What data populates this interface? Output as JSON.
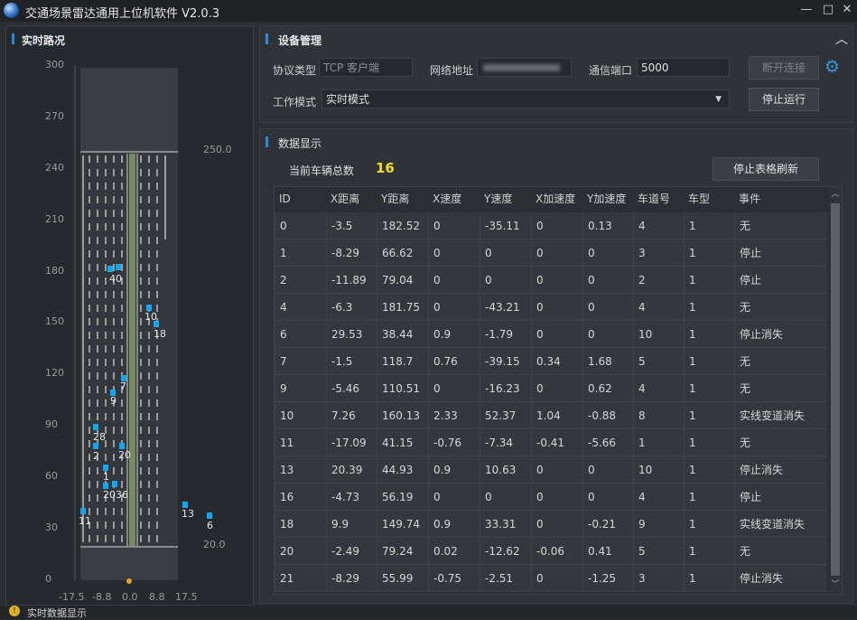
{
  "window": {
    "title": "交通场景雷达通用上位机软件 V2.0.3",
    "controls": {
      "minimize": "—",
      "maximize": "□",
      "close": "✕"
    }
  },
  "road": {
    "title": "实时路况",
    "y_ticks": [
      "300",
      "270",
      "240",
      "210",
      "180",
      "150",
      "120",
      "90",
      "60",
      "30",
      "0"
    ],
    "x_ticks": [
      "-17.5",
      "-8.8",
      "0.0",
      "8.8",
      "17.5"
    ],
    "dist_top": "250.0",
    "dist_bottom": "20.0",
    "vehicles": [
      {
        "label": "40",
        "y": 182,
        "lane": 0
      },
      {
        "label": "10",
        "y": 160,
        "lane": 0
      },
      {
        "label": "18",
        "y": 150,
        "lane": 0
      },
      {
        "label": "7",
        "y": 118,
        "lane": 0
      },
      {
        "label": "9",
        "y": 110,
        "lane": 0
      },
      {
        "label": "28",
        "y": 90,
        "lane": 0
      },
      {
        "label": "2",
        "y": 79,
        "lane": 0
      },
      {
        "label": "20",
        "y": 79,
        "lane": 0
      },
      {
        "label": "1",
        "y": 66,
        "lane": 0
      },
      {
        "label": "2036",
        "y": 56,
        "lane": 0
      },
      {
        "label": "11",
        "y": 41,
        "lane": 0
      },
      {
        "label": "13",
        "y": 44,
        "lane": 0
      },
      {
        "label": "6",
        "y": 38,
        "lane": 0
      }
    ]
  },
  "device": {
    "title": "设备管理",
    "protocol_label": "协议类型",
    "protocol_value": "TCP 客户端",
    "address_label": "网络地址",
    "port_label": "通信端口",
    "port_value": "5000",
    "disconnect_label": "断开连接",
    "mode_label": "工作模式",
    "mode_value": "实时模式",
    "stop_label": "停止运行"
  },
  "data": {
    "title": "数据显示",
    "count_label": "当前车辆总数",
    "count_value": "16",
    "stop_refresh_label": "停止表格刷新",
    "columns": [
      "ID",
      "X距离",
      "Y距离",
      "X速度",
      "Y速度",
      "X加速度",
      "Y加速度",
      "车道号",
      "车型",
      "事件"
    ],
    "rows": [
      [
        "0",
        "-3.5",
        "182.52",
        "0",
        "-35.11",
        "0",
        "0.13",
        "4",
        "1",
        "无"
      ],
      [
        "1",
        "-8.29",
        "66.62",
        "0",
        "0",
        "0",
        "0",
        "3",
        "1",
        "停止"
      ],
      [
        "2",
        "-11.89",
        "79.04",
        "0",
        "0",
        "0",
        "0",
        "2",
        "1",
        "停止"
      ],
      [
        "4",
        "-6.3",
        "181.75",
        "0",
        "-43.21",
        "0",
        "0",
        "4",
        "1",
        "无"
      ],
      [
        "6",
        "29.53",
        "38.44",
        "0.9",
        "-1.79",
        "0",
        "0",
        "10",
        "1",
        "停止消失"
      ],
      [
        "7",
        "-1.5",
        "118.7",
        "0.76",
        "-39.15",
        "0.34",
        "1.68",
        "5",
        "1",
        "无"
      ],
      [
        "9",
        "-5.46",
        "110.51",
        "0",
        "-16.23",
        "0",
        "0.62",
        "4",
        "1",
        "无"
      ],
      [
        "10",
        "7.26",
        "160.13",
        "2.33",
        "52.37",
        "1.04",
        "-0.88",
        "8",
        "1",
        "实线变道消失"
      ],
      [
        "11",
        "-17.09",
        "41.15",
        "-0.76",
        "-7.34",
        "-0.41",
        "-5.66",
        "1",
        "1",
        "无"
      ],
      [
        "13",
        "20.39",
        "44.93",
        "0.9",
        "10.63",
        "0",
        "0",
        "10",
        "1",
        "停止消失"
      ],
      [
        "16",
        "-4.73",
        "56.19",
        "0",
        "0",
        "0",
        "0",
        "4",
        "1",
        "停止"
      ],
      [
        "18",
        "9.9",
        "149.74",
        "0.9",
        "33.31",
        "0",
        "-0.21",
        "9",
        "1",
        "实线变道消失"
      ],
      [
        "20",
        "-2.49",
        "79.24",
        "0.02",
        "-12.62",
        "-0.06",
        "0.41",
        "5",
        "1",
        "无"
      ],
      [
        "21",
        "-8.29",
        "55.99",
        "-0.75",
        "-2.51",
        "0",
        "-1.25",
        "3",
        "1",
        "停止消失"
      ]
    ]
  },
  "status": {
    "text": "实时数据显示"
  }
}
